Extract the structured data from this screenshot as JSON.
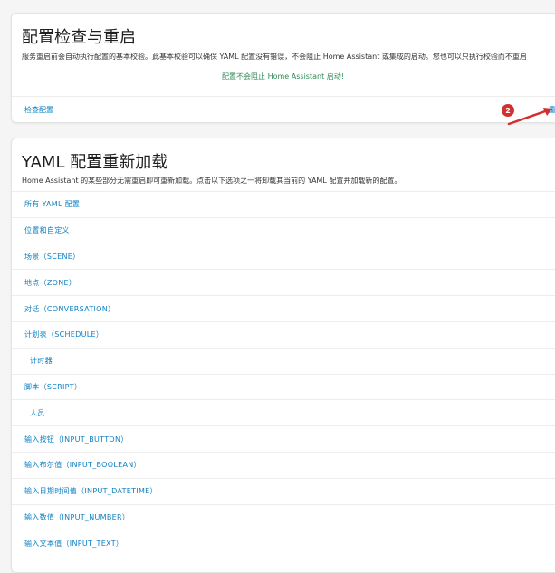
{
  "config_check": {
    "title": "配置检查与重启",
    "description": "服务重启前会自动执行配置的基本校验。此基本校验可以确保 YAML 配置没有错误，不会阻止 Home Assistant 或集成的启动。您也可以只执行校验而不重启",
    "success_message": "配置不会阻止 Home Assistant 启动!",
    "check_link": "检查配置",
    "restart_link": "重"
  },
  "annotation": {
    "badge": "2",
    "color": "#d32f2f"
  },
  "yaml_reload": {
    "title": "YAML 配置重新加载",
    "description": "Home Assistant 的某些部分无需重启即可重新加载。点击以下选项之一将卸载其当前的 YAML 配置并加载新的配置。",
    "items": [
      "所有 YAML 配置",
      "位置和自定义",
      "场景（SCENE）",
      "地点（ZONE）",
      "对话（CONVERSATION）",
      "计划表（SCHEDULE）",
      "计时器",
      "脚本（SCRIPT）",
      "人员",
      "输入按钮（INPUT_BUTTON）",
      "输入布尔值（INPUT_BOOLEAN）",
      "输入日期时间值（INPUT_DATETIME）",
      "输入数值（INPUT_NUMBER）",
      "输入文本值（INPUT_TEXT）"
    ]
  },
  "colors": {
    "link": "#0b7fc3",
    "success": "#2e8b57"
  }
}
